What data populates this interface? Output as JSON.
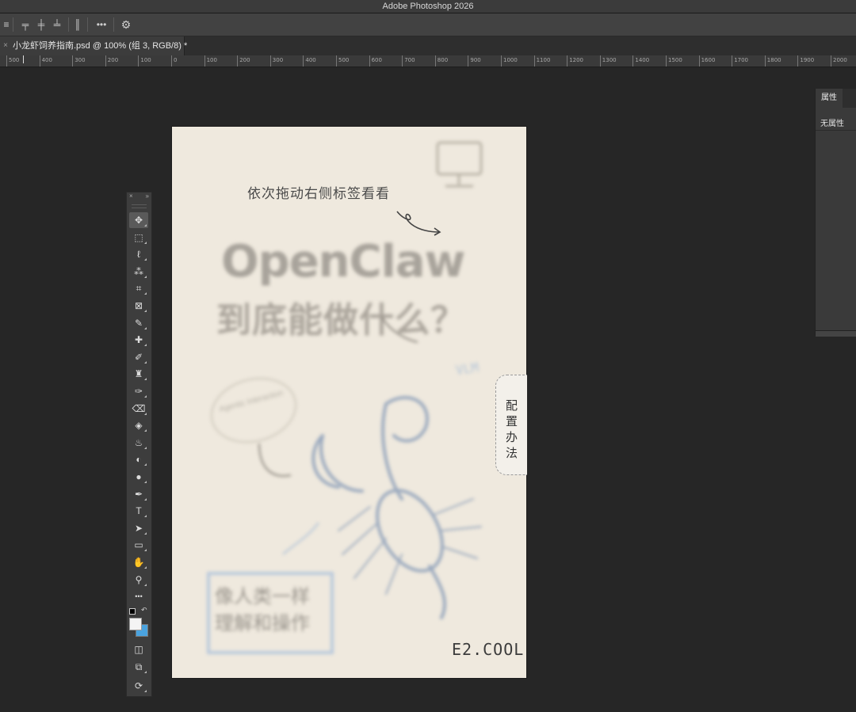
{
  "app": {
    "title": "Adobe Photoshop 2026"
  },
  "options_bar": {
    "icons": [
      "align-left-icon",
      "align-top-icon",
      "align-vcenter-icon",
      "align-bottom-icon",
      "distribute-icon",
      "more-icon",
      "gear-icon"
    ],
    "more_label": "•••",
    "gear_label": "⚙"
  },
  "document_tab": {
    "close": "×",
    "label": "小龙虾饲养指南.psd @ 100% (组 3, RGB/8) *"
  },
  "ruler": {
    "ticks": [
      "500",
      "400",
      "300",
      "200",
      "100",
      "0",
      "100",
      "200",
      "300",
      "400",
      "500",
      "600",
      "700",
      "800",
      "900",
      "1000",
      "1100",
      "1200",
      "1300",
      "1400",
      "1500",
      "1600",
      "1700",
      "1800",
      "1900",
      "2000"
    ]
  },
  "toolbar": {
    "close": "×",
    "expand": "»",
    "tools": [
      {
        "name": "move-tool",
        "glyph": "✥",
        "active": true
      },
      {
        "name": "marquee-tool",
        "glyph": "⬚"
      },
      {
        "name": "lasso-tool",
        "glyph": "ℓ"
      },
      {
        "name": "magic-wand-tool",
        "glyph": "⁂"
      },
      {
        "name": "crop-tool",
        "glyph": "⌗"
      },
      {
        "name": "frame-tool",
        "glyph": "⊠"
      },
      {
        "name": "eyedropper-tool",
        "glyph": "✎"
      },
      {
        "name": "healing-brush-tool",
        "glyph": "✚"
      },
      {
        "name": "brush-tool",
        "glyph": "✐"
      },
      {
        "name": "clone-stamp-tool",
        "glyph": "♜"
      },
      {
        "name": "history-brush-tool",
        "glyph": "✑"
      },
      {
        "name": "eraser-tool",
        "glyph": "⌫"
      },
      {
        "name": "paint-bucket-tool",
        "glyph": "◈"
      },
      {
        "name": "blur-tool",
        "glyph": "♨"
      },
      {
        "name": "dodge-tool",
        "glyph": "◐"
      },
      {
        "name": "burn-tool",
        "glyph": "●"
      },
      {
        "name": "pen-tool",
        "glyph": "✒"
      },
      {
        "name": "type-tool",
        "glyph": "T"
      },
      {
        "name": "path-select-tool",
        "glyph": "➤"
      },
      {
        "name": "rectangle-tool",
        "glyph": "▭"
      },
      {
        "name": "hand-tool",
        "glyph": "✋"
      },
      {
        "name": "zoom-tool",
        "glyph": "⚲"
      },
      {
        "name": "more-tools",
        "glyph": "•••"
      }
    ],
    "swap": "↶",
    "quick_mask": "◫",
    "screen_mode": "⧉",
    "extra": "⟳"
  },
  "canvas": {
    "hint": "依次拖动右侧标签看看",
    "title": "OpenClaw",
    "subtitle": "到底能做什么？",
    "vlm": "VLM",
    "bubble": "Agentic Interaction",
    "sticker": "像人类一样理解和操作",
    "footer": "E2.COOL",
    "sidetab": "配置办法"
  },
  "properties_panel": {
    "tab": "属性",
    "empty": "无属性"
  },
  "colors": {
    "background": "#262626",
    "canvas": "#efe9de",
    "accent": "#4aa3df"
  }
}
